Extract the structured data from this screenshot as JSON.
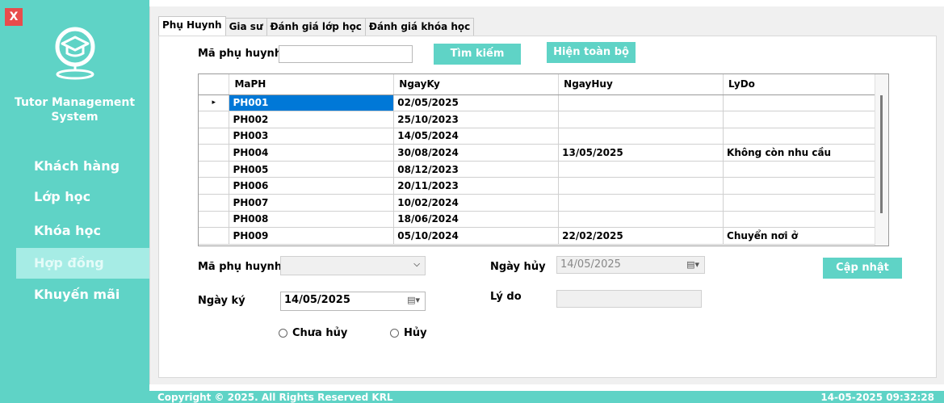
{
  "sidebar": {
    "close_label": "X",
    "app_title": "Tutor Management\nSystem",
    "items": [
      {
        "label": "Khách hàng"
      },
      {
        "label": "Lớp học"
      },
      {
        "label": "Khóa học"
      },
      {
        "label": "Hợp đồng",
        "active": true
      },
      {
        "label": "Khuyến mãi"
      }
    ]
  },
  "tabs": [
    {
      "label": "Phụ Huynh",
      "active": true
    },
    {
      "label": "Gia sư"
    },
    {
      "label": "Đánh giá lớp học"
    },
    {
      "label": "Đánh giá khóa học"
    }
  ],
  "search": {
    "label": "Mã phụ huynh",
    "value": "",
    "search_button": "Tìm kiếm",
    "show_all_button": "Hiện toàn bộ"
  },
  "grid": {
    "columns": [
      "MaPH",
      "NgayKy",
      "NgayHuy",
      "LyDo"
    ],
    "rows": [
      [
        "PH001",
        "02/05/2025",
        "",
        ""
      ],
      [
        "PH002",
        "25/10/2023",
        "",
        ""
      ],
      [
        "PH003",
        "14/05/2024",
        "",
        ""
      ],
      [
        "PH004",
        "30/08/2024",
        "13/05/2025",
        "Không còn nhu cầu"
      ],
      [
        "PH005",
        "08/12/2023",
        "",
        ""
      ],
      [
        "PH006",
        "20/11/2023",
        "",
        ""
      ],
      [
        "PH007",
        "10/02/2024",
        "",
        ""
      ],
      [
        "PH008",
        "18/06/2024",
        "",
        ""
      ],
      [
        "PH009",
        "05/10/2024",
        "22/02/2025",
        "Chuyển nơi ở"
      ]
    ],
    "current_row_marker": "▸"
  },
  "form": {
    "ma_ph_label": "Mã phụ huynh",
    "ma_ph_value": "",
    "ngay_huy_label": "Ngày hủy",
    "ngay_huy_value": "14/05/2025",
    "ngay_ky_label": "Ngày ký",
    "ngay_ky_value": "14/05/2025",
    "ly_do_label": "Lý do",
    "ly_do_value": "",
    "update_button": "Cập nhật",
    "radio_not_cancelled": "Chưa hủy",
    "radio_cancelled": "Hủy"
  },
  "footer": {
    "copyright": "Copyright © 2025. All Rights Reserved KRL",
    "datetime": "14-05-2025   09:32:28"
  },
  "colors": {
    "accent": "#5fd3c6",
    "active_nav": "#a6ece5",
    "selection": "#0078d7",
    "close": "#e84c4c"
  }
}
